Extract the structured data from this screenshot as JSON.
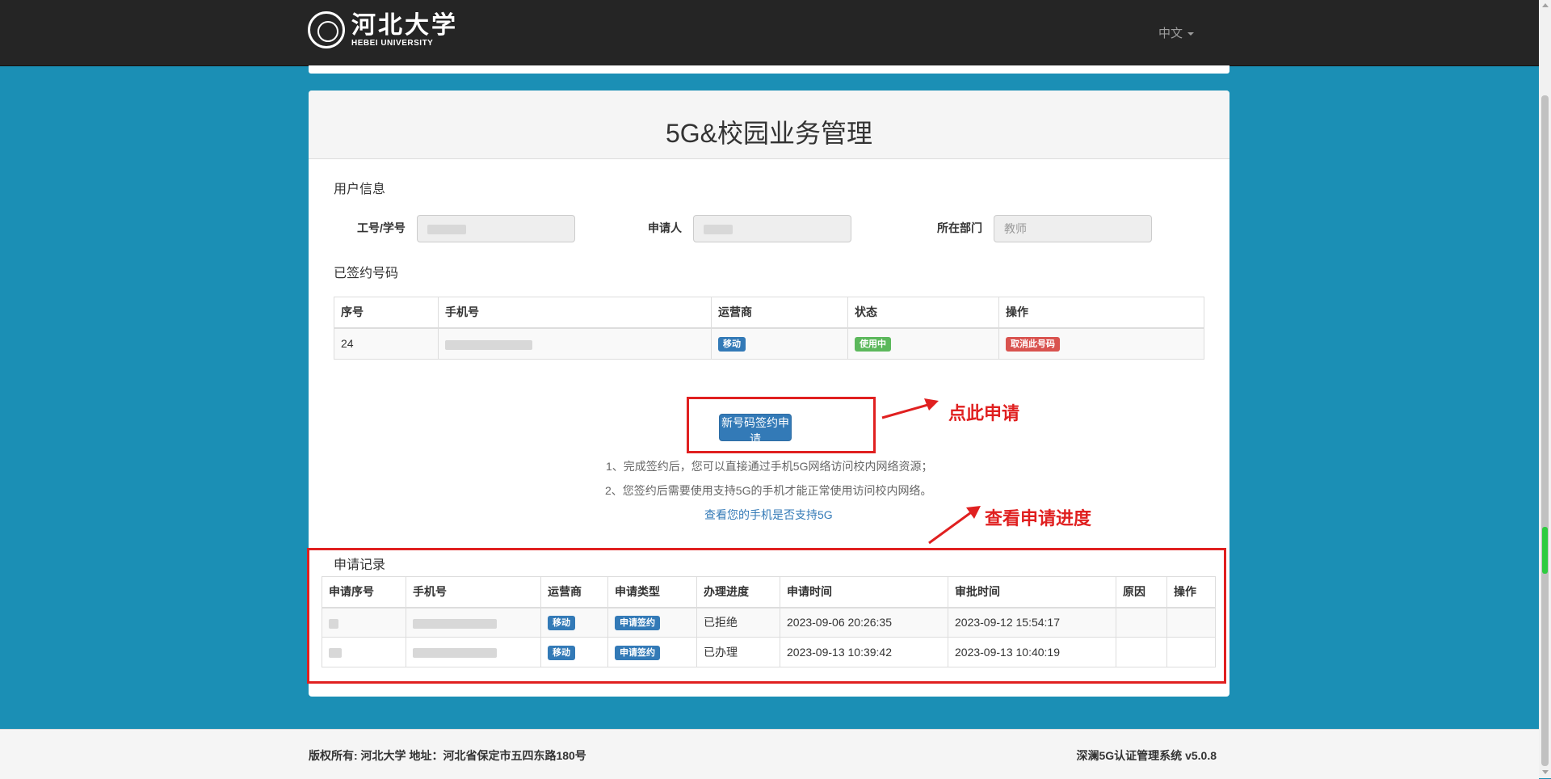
{
  "header": {
    "logo_cn": "河北大学",
    "logo_en": "HEBEI UNIVERSITY",
    "language": "中文"
  },
  "panel": {
    "title": "5G&校园业务管理"
  },
  "user_info": {
    "section_title": "用户信息",
    "id_label": "工号/学号",
    "id_value": "",
    "applicant_label": "申请人",
    "applicant_value": "",
    "dept_label": "所在部门",
    "dept_value": "教师"
  },
  "signed": {
    "section_title": "已签约号码",
    "headers": [
      "序号",
      "手机号",
      "运营商",
      "状态",
      "操作"
    ],
    "rows": [
      {
        "index": "24",
        "phone": "",
        "carrier": "移动",
        "status": "使用中",
        "action": "取消此号码"
      }
    ]
  },
  "apply": {
    "button": "新号码签约申请",
    "note1": "1、完成签约后，您可以直接通过手机5G网络访问校内网络资源；",
    "note2": "2、您签约后需要使用支持5G的手机才能正常使用访问校内网络。",
    "link": "查看您的手机是否支持5G"
  },
  "annotations": {
    "click_here": "点此申请",
    "view_progress": "查看申请进度"
  },
  "records": {
    "section_title": "申请记录",
    "headers": [
      "申请序号",
      "手机号",
      "运营商",
      "申请类型",
      "办理进度",
      "申请时间",
      "审批时间",
      "原因",
      "操作"
    ],
    "rows": [
      {
        "id": "",
        "phone": "",
        "carrier": "移动",
        "type": "申请签约",
        "progress": "已拒绝",
        "apply_time": "2023-09-06 20:26:35",
        "approve_time": "2023-09-12 15:54:17",
        "reason": "",
        "action": ""
      },
      {
        "id": "",
        "phone": "",
        "carrier": "移动",
        "type": "申请签约",
        "progress": "已办理",
        "apply_time": "2023-09-13 10:39:42",
        "approve_time": "2023-09-13 10:40:19",
        "reason": "",
        "action": ""
      }
    ]
  },
  "footer": {
    "copyright": "版权所有: 河北大学  地址：河北省保定市五四东路180号",
    "system": "深澜5G认证管理系统 v5.0.8"
  },
  "colors": {
    "background": "#1b8fb5",
    "topbar": "#252525",
    "primary": "#337ab7",
    "success": "#5cb85c",
    "danger": "#d9534f",
    "annotation": "#e02020"
  }
}
